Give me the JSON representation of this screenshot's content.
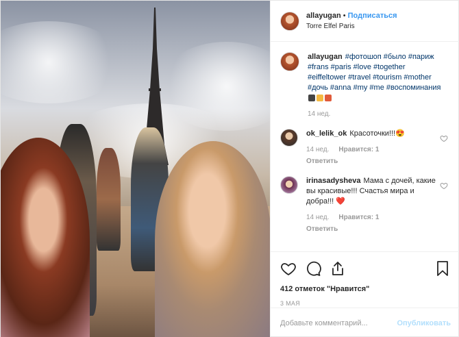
{
  "header": {
    "username": "allayugan",
    "separator": "•",
    "follow_label": "Подписаться",
    "location": "Torre Elfel Paris"
  },
  "caption": {
    "username": "allayugan",
    "text": "#фотошоп #было #париж #frans #paris #love #together #eiffeltower #travel #tourism #mother #дочь #anna #my #me #воспоминания",
    "time": "14 нед."
  },
  "comments": [
    {
      "username": "ok_lelik_ok",
      "text": "Красоточки!!!😍",
      "time": "14 нед.",
      "likes": "Нравится: 1",
      "reply": "Ответить"
    },
    {
      "username": "irinasadysheva",
      "text": "Мама с дочей, какие вы красивые!!! Счастья мира и добра!!! ❤️",
      "time": "14 нед.",
      "likes": "Нравится: 1",
      "reply": "Ответить"
    }
  ],
  "actions": {
    "likes_count": "412 отметок \"Нравится\"",
    "date": "3 МАЯ"
  },
  "add_comment": {
    "placeholder": "Добавьте комментарий...",
    "publish_label": "Опубликовать"
  },
  "colors": {
    "link_blue": "#3897f0",
    "hashtag": "#003569",
    "muted": "#999999",
    "publish_disabled": "#b2dffc"
  },
  "icons": [
    "heart-icon",
    "comment-icon",
    "share-icon",
    "bookmark-icon"
  ]
}
